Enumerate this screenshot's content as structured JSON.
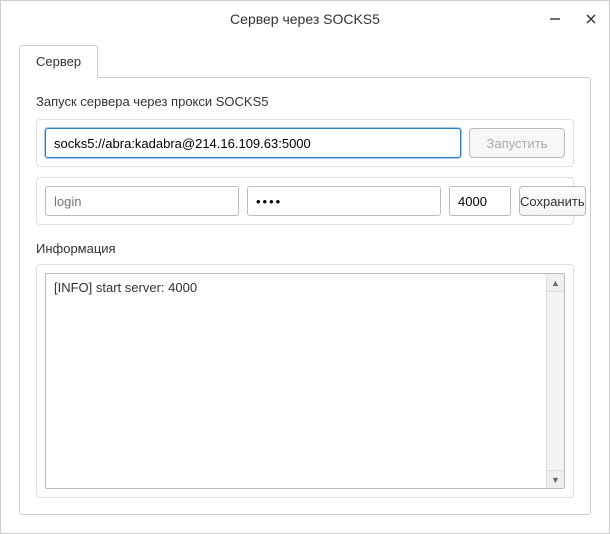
{
  "window": {
    "title": "Сервер через SOCKS5"
  },
  "tabs": {
    "server": "Сервер"
  },
  "form": {
    "heading": "Запуск сервера через прокси SOCKS5",
    "url": "socks5://abra:kadabra@214.16.109.63:5000",
    "login_placeholder": "login",
    "login_value": "",
    "password_value": "••••",
    "port_value": "4000",
    "start_label": "Запустить",
    "save_label": "Сохранить"
  },
  "info": {
    "heading": "Информация",
    "log": "[INFO] start server: 4000"
  }
}
